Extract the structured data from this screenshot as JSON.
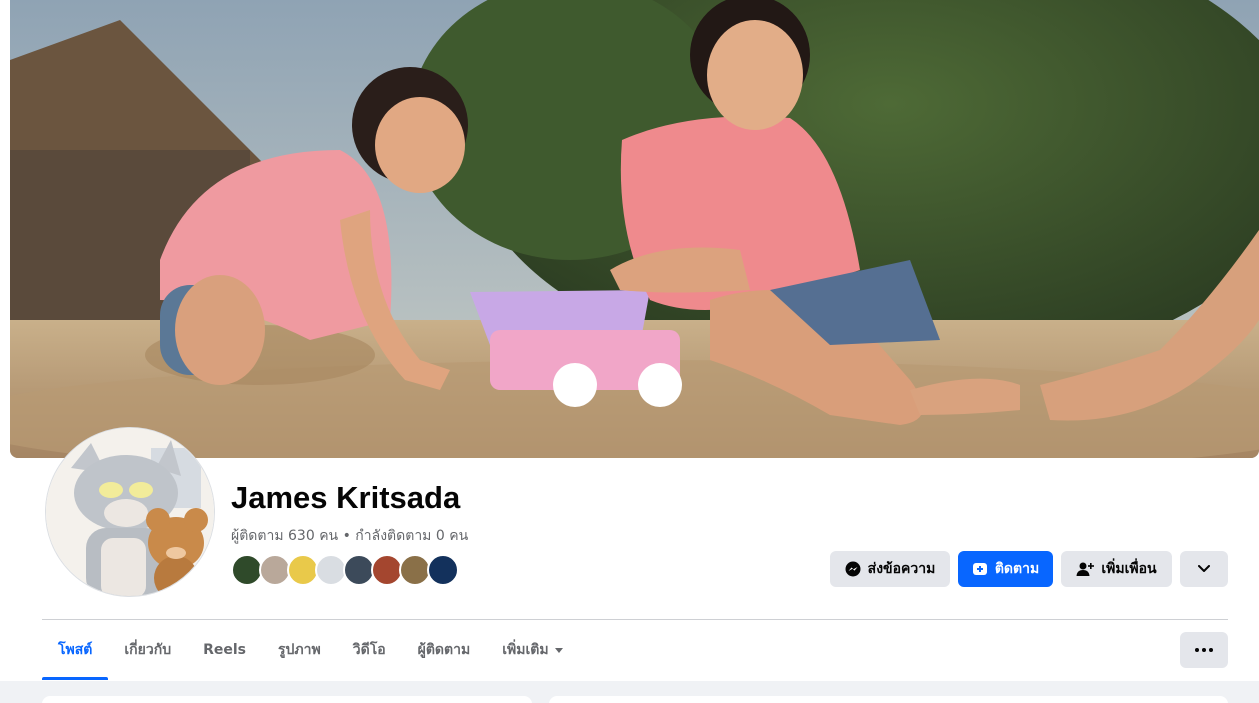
{
  "profile": {
    "name": "James Kritsada",
    "follow_stats": "ผู้ติดตาม 630 คน • กำลังติดตาม 0 คน",
    "friend_avatars": [
      {
        "color": "#2f4a2a"
      },
      {
        "color": "#b9a89a"
      },
      {
        "color": "#e9c94a"
      },
      {
        "color": "#d9dde2"
      },
      {
        "color": "#3c4a5a"
      },
      {
        "color": "#a4462f"
      },
      {
        "color": "#8a7048"
      },
      {
        "color": "#13315c"
      }
    ]
  },
  "actions": {
    "message_label": "ส่งข้อความ",
    "follow_label": "ติดตาม",
    "add_friend_label": "เพิ่มเพื่อน"
  },
  "tabs": [
    {
      "label": "โพสต์",
      "active": true
    },
    {
      "label": "เกี่ยวกับ",
      "active": false
    },
    {
      "label": "Reels",
      "active": false
    },
    {
      "label": "รูปภาพ",
      "active": false
    },
    {
      "label": "วิดีโอ",
      "active": false
    },
    {
      "label": "ผู้ติดตาม",
      "active": false
    },
    {
      "label": "เพิ่มเติม",
      "active": false
    }
  ],
  "icons": {
    "messenger": "messenger-icon",
    "follow": "follow-icon",
    "add_friend": "add-friend-icon",
    "dropdown": "chevron-down-icon",
    "more": "more-options-icon"
  },
  "colors": {
    "accent": "#0866ff",
    "button_gray": "#e4e6eb",
    "text_primary": "#050505",
    "text_secondary": "#65676b"
  }
}
